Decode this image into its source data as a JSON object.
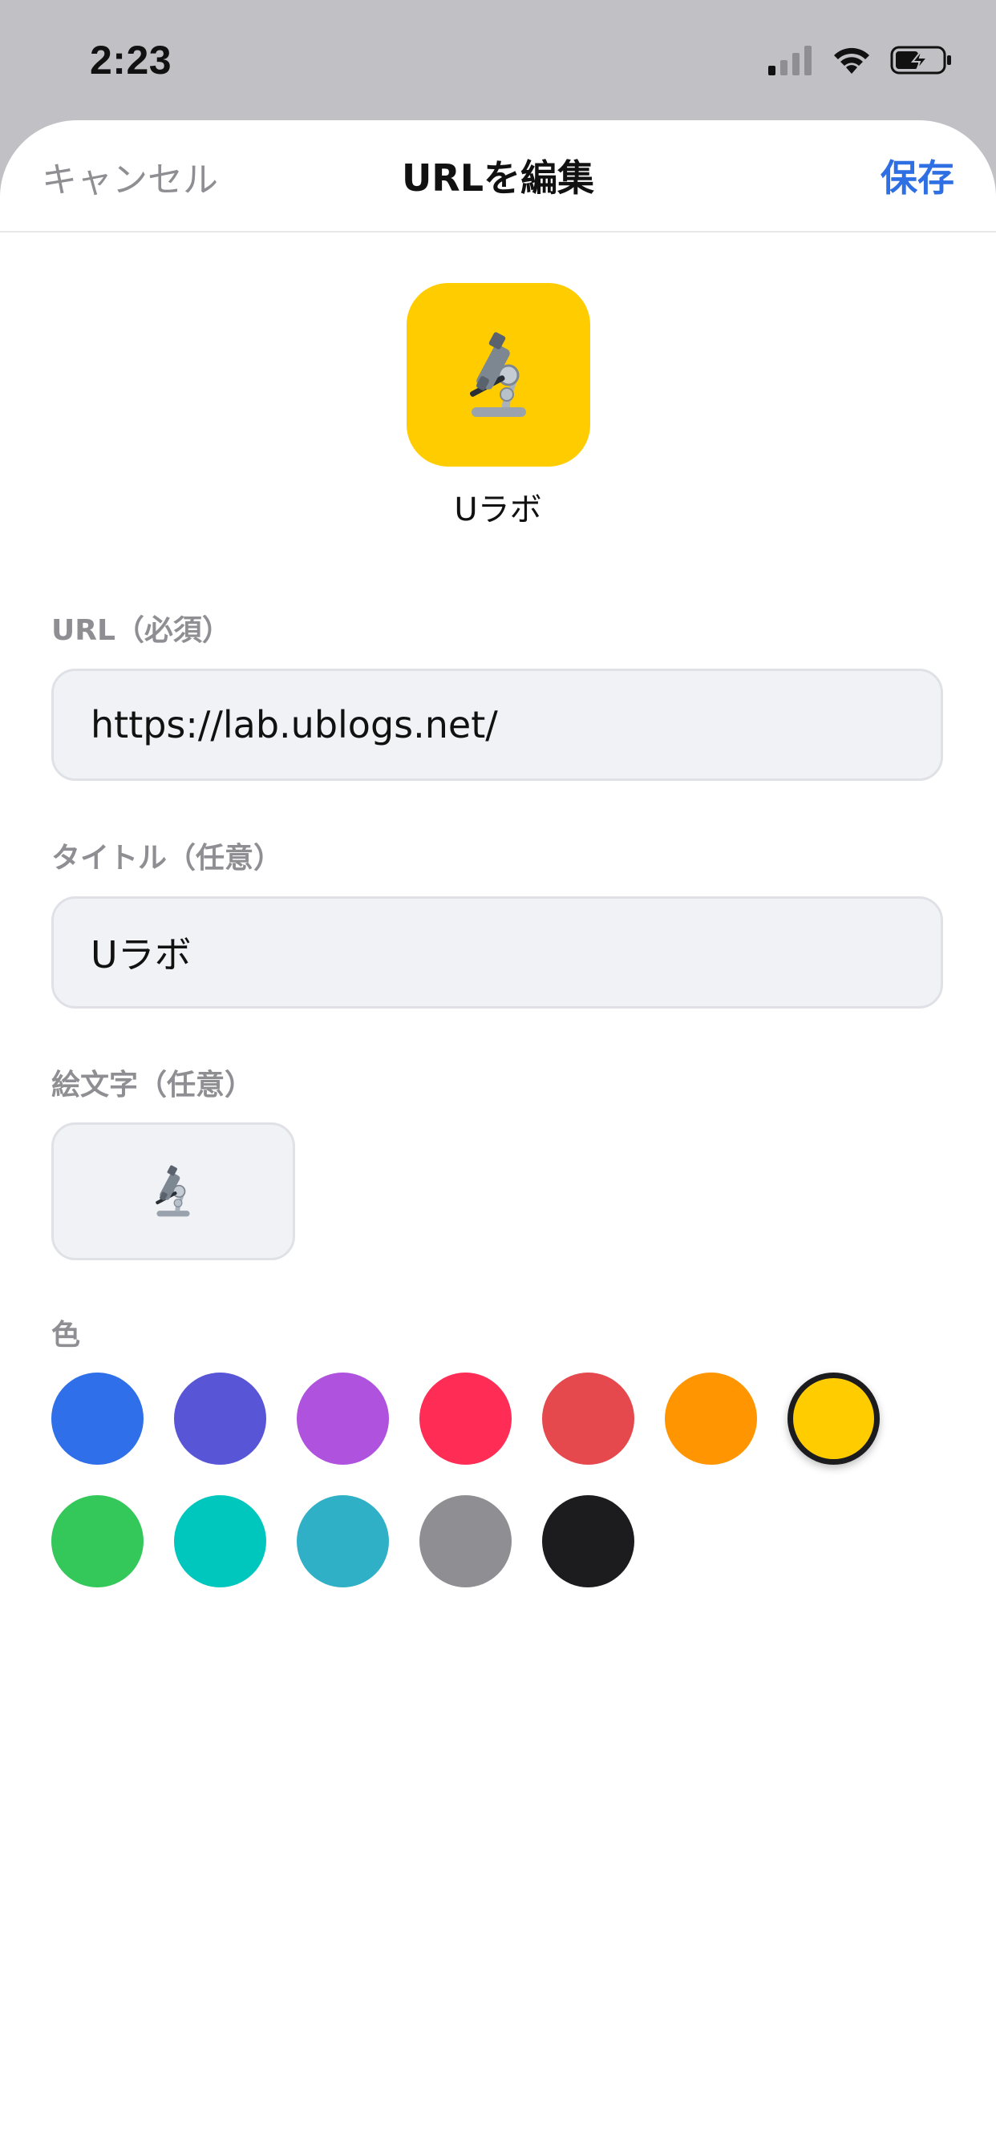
{
  "status_bar": {
    "time": "2:23"
  },
  "nav": {
    "cancel_label": "キャンセル",
    "title": "URLを編集",
    "save_label": "保存"
  },
  "preview": {
    "emoji": "🔬",
    "label": "Uラボ",
    "background_color": "#ffcc00"
  },
  "form": {
    "url": {
      "label": "URL（必須）",
      "value": "https://lab.ublogs.net/"
    },
    "title": {
      "label": "タイトル（任意）",
      "value": "Uラボ"
    },
    "emoji": {
      "label": "絵文字（任意）",
      "value": "🔬"
    },
    "color": {
      "label": "色",
      "selected": "#ffcc00",
      "swatches": [
        "#2f6fe9",
        "#5856d6",
        "#af52de",
        "#ff2d55",
        "#e5484d",
        "#ff9500",
        "#ffcc00",
        "#34c759",
        "#00c7be",
        "#30b0c7",
        "#8e8e93",
        "#1c1c1e"
      ]
    }
  },
  "colors": {
    "accent": "#2f6fe4",
    "secondary_text": "#8e8e93"
  }
}
